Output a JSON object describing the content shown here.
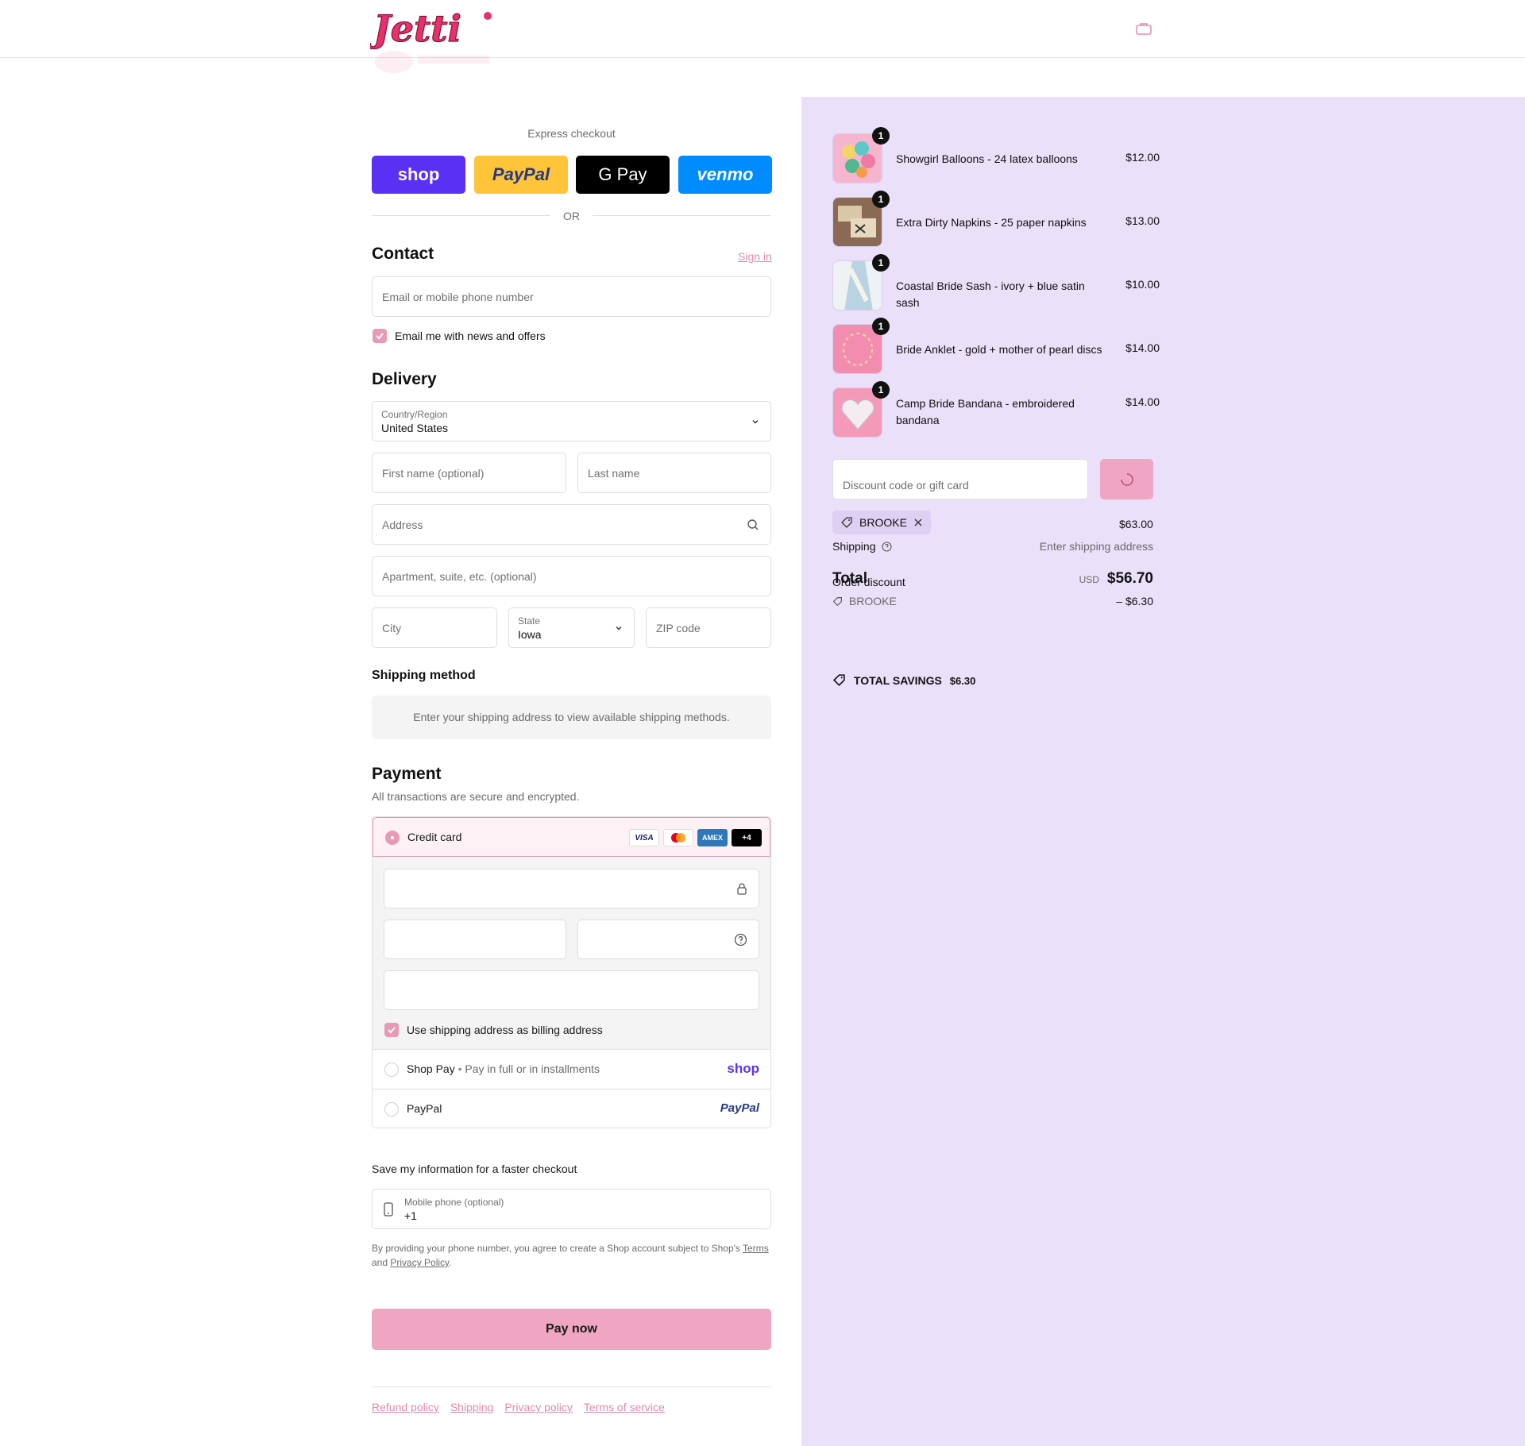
{
  "brand": {
    "logo_text": "Jetti",
    "accent": "#e6316b",
    "pink": "#f0a6c2",
    "lavender": "#eae0fa"
  },
  "header": {
    "cart_icon": "bag-icon"
  },
  "express": {
    "title": "Express checkout",
    "buttons": [
      {
        "label": "shop",
        "bg": "#5a31f4",
        "fg": "#ffffff"
      },
      {
        "label": "PayPal",
        "bg": "#ffc439",
        "fg": "#253b80"
      },
      {
        "label": "G Pay",
        "bg": "#000000",
        "fg": "#ffffff"
      },
      {
        "label": "venmo",
        "bg": "#008cff",
        "fg": "#ffffff"
      }
    ],
    "or_label": "OR"
  },
  "contact": {
    "heading": "Contact",
    "sign_in": "Sign in",
    "email_placeholder": "Email or mobile phone number",
    "news_label": "Email me with news and offers",
    "news_checked": true
  },
  "delivery": {
    "heading": "Delivery",
    "country_label": "Country/Region",
    "country_value": "United States",
    "first_name_placeholder": "First name (optional)",
    "last_name_placeholder": "Last name",
    "address_placeholder": "Address",
    "apartment_placeholder": "Apartment, suite, etc. (optional)",
    "city_placeholder": "City",
    "state_label": "State",
    "state_value": "Iowa",
    "zip_placeholder": "ZIP code"
  },
  "shipping_method": {
    "heading": "Shipping method",
    "notice": "Enter your shipping address to view available shipping methods."
  },
  "payment": {
    "heading": "Payment",
    "subtitle": "All transactions are secure and encrypted.",
    "credit_card_label": "Credit card",
    "card_badges": [
      "VISA",
      "MC",
      "AMEX",
      "+4"
    ],
    "billing_label": "Use shipping address as billing address",
    "billing_checked": true,
    "shop_pay_label": "Shop Pay",
    "shop_pay_sub": "Pay in full or in installments",
    "shop_logo": "shop",
    "paypal_label": "PayPal",
    "paypal_logo": "PayPal"
  },
  "save_info": {
    "heading": "Save my information for a faster checkout",
    "phone_label": "Mobile phone (optional)",
    "phone_value": "+1",
    "legal_prefix": "By providing your phone number, you agree to create a Shop account subject to Shop's",
    "terms_link": "Terms",
    "and_text": "and",
    "privacy_link": "Privacy Policy",
    "period": "."
  },
  "pay_now": "Pay now",
  "footer": {
    "links": [
      "Refund policy",
      "Shipping",
      "Privacy policy",
      "Terms of service"
    ]
  },
  "cart": {
    "items": [
      {
        "name": "Showgirl Balloons - 24 latex balloons",
        "price": "$12.00",
        "qty": "1"
      },
      {
        "name": "Extra Dirty Napkins - 25 paper napkins",
        "price": "$13.00",
        "qty": "1"
      },
      {
        "name": "Coastal Bride Sash - ivory + blue satin sash",
        "price": "$10.00",
        "qty": "1"
      },
      {
        "name": "Bride Anklet - gold + mother of pearl discs",
        "price": "$14.00",
        "qty": "1"
      },
      {
        "name": "Camp Bride Bandana - embroidered bandana",
        "price": "$14.00",
        "qty": "1"
      }
    ],
    "discount_placeholder": "Discount code or gift card",
    "applied_code": "BROOKE",
    "subtotal_value": "$63.00",
    "shipping_label": "Shipping",
    "shipping_value": "Enter shipping address",
    "total_label": "Total",
    "order_discount_label": "Order discount",
    "currency": "USD",
    "total_value": "$56.70",
    "discount_code": "BROOKE",
    "discount_value": "– $6.30",
    "savings_label": "TOTAL SAVINGS",
    "savings_value": "$6.30"
  }
}
